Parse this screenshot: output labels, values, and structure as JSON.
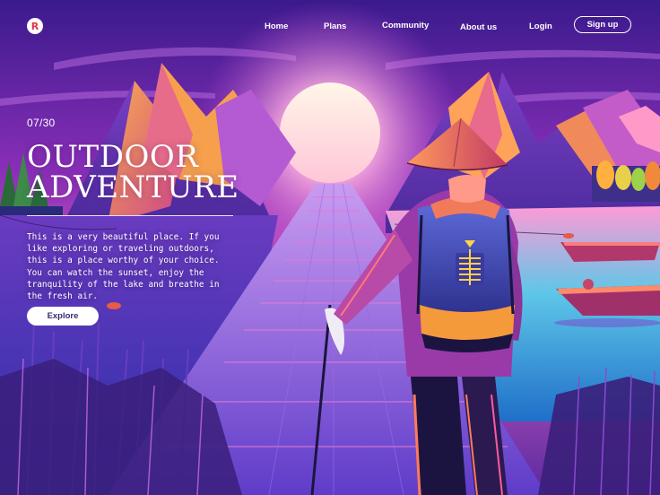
{
  "logo": {
    "glyph": "R",
    "icon": "brand-logo-icon"
  },
  "nav": {
    "home": "Home",
    "plans": "Plans",
    "community": "Community",
    "about": "About us",
    "login": "Login",
    "signup": "Sign up"
  },
  "hero": {
    "counter": "07/30",
    "title_line1": "OUTDOOR",
    "title_line2": "ADVENTURE",
    "description": "This is a very beautiful place. If you like exploring or traveling outdoors, this is a place worthy of your choice. You can watch the sunset, enjoy the tranquility of the lake and breathe in the fresh air.",
    "cta": "Explore"
  },
  "colors": {
    "accent": "#e4324b",
    "sky_top": "#3a1a8c",
    "sky_glow": "#ff8fd0",
    "button_text": "#3b2a6d"
  }
}
